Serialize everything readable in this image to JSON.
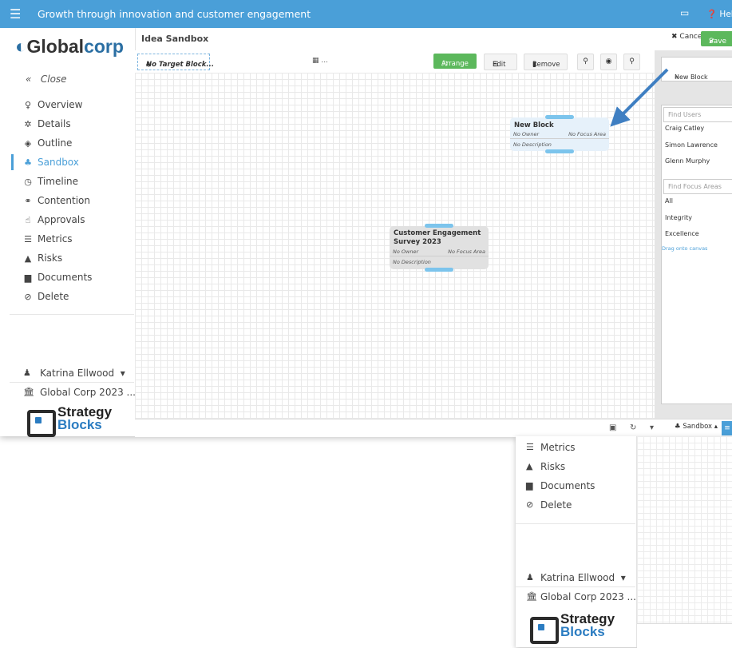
{
  "topbar": {
    "title": "Growth through innovation and customer engagement",
    "help_label": "Help"
  },
  "brand": {
    "name_prefix": "Global",
    "name_suffix": "corp"
  },
  "sidebar": {
    "close_label": "Close",
    "items": [
      {
        "label": "Overview",
        "icon": "lightbulb-icon"
      },
      {
        "label": "Details",
        "icon": "gear-icon"
      },
      {
        "label": "Outline",
        "icon": "cube-icon"
      },
      {
        "label": "Sandbox",
        "icon": "sitemap-icon",
        "active": true
      },
      {
        "label": "Timeline",
        "icon": "clock-icon"
      },
      {
        "label": "Contention",
        "icon": "handshake-icon"
      },
      {
        "label": "Approvals",
        "icon": "thumbs-up-icon"
      },
      {
        "label": "Metrics",
        "icon": "metrics-icon"
      },
      {
        "label": "Risks",
        "icon": "warning-icon"
      },
      {
        "label": "Documents",
        "icon": "document-icon"
      },
      {
        "label": "Delete",
        "icon": "ban-icon"
      }
    ],
    "user_name": "Katrina Ellwood",
    "org_name": "Global Corp 2023 ..."
  },
  "footer_logo": {
    "line1": "Strategy",
    "line2": "Blocks"
  },
  "header": {
    "title": "Idea Sandbox",
    "cancel_label": "Cancel",
    "save_label": "Save"
  },
  "toolbar": {
    "target_label": "No Target Block...",
    "date_label": "...",
    "arrange_label": "Arrange",
    "edit_label": "Edit",
    "remove_label": "Remove"
  },
  "canvas": {
    "blocks": [
      {
        "name": "New Block",
        "owner": "No Owner",
        "focus": "No Focus Area",
        "description": "No Description"
      },
      {
        "name": "Customer Engagement Survey 2023",
        "owner": "No Owner",
        "focus": "No Focus Area",
        "description": "No Description"
      }
    ]
  },
  "right_panel": {
    "new_block_label": "New Block",
    "find_users_placeholder": "Find Users",
    "users": [
      "Craig Catley",
      "Simon Lawrence",
      "Glenn Murphy"
    ],
    "find_focus_placeholder": "Find Focus Areas",
    "focus_areas": [
      "All",
      "Integrity",
      "Excellence"
    ],
    "drag_hint": "Drag onto canvas"
  },
  "bottom_bar": {
    "view_label": "Sandbox"
  },
  "colors": {
    "topbar": "#4a9fd8",
    "save_green": "#5cb85c",
    "accent_blue": "#2b6fa3",
    "knob_blue": "#7cc4ec",
    "arrow_blue": "#3f7fc2"
  }
}
